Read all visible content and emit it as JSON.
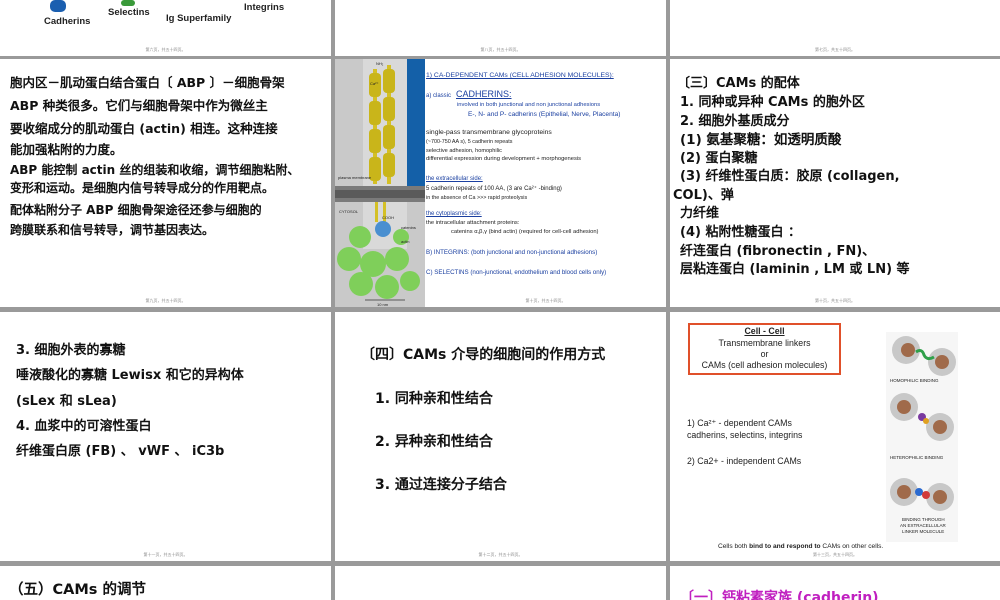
{
  "top_row": {
    "labels": [
      "Cadherins",
      "Selectins",
      "Ig Superfamily",
      "Integrins"
    ]
  },
  "footers": {
    "s_top1": "第六页，共五十四页。",
    "s_top2": "第八页，共五十四页。",
    "s_top3": "第七页，共五十四页。",
    "s1": "第九页，共五十四页。",
    "s2": "第十页，共五十四页。",
    "s3": "第十页，共五十四页。",
    "s4": "第十一页，共五十四页。",
    "s5": "第十二页，共五十四页。",
    "s6": "第十三页，共五十四页。"
  },
  "slide1": {
    "lines": [
      "胞内区－肌动蛋白结合蛋白〔 ABP 〕－细胞骨架",
      "  ABP 种类很多。它们与细胞骨架中作为微丝主",
      "要收缩成分的肌动蛋白 (actin) 相连。这种连接",
      "能加强粘附的力度。",
      "    ABP 能控制 actin 丝的组装和收缩，调节细胞粘附、",
      "变形和运动。是细胞内信号转导成分的作用靶点。",
      "    配体粘附分子 ABP 细胞骨架途径还参与细胞的",
      "跨膜联系和信号转导，调节基因表达。"
    ]
  },
  "slide2": {
    "heading1": "1)  CA-DEPENDENT CAMs  (CELL ADHESION MOLECULES):",
    "classic": "a)  classic",
    "cadherins": "CADHERINS:",
    "c1": "involved in both junctional and non junctional adhesions",
    "c2": "E-, N- and P- cadherins (Epithelial, Nerve, Placenta)",
    "sp": "single-pass transmembrane glycoproteins",
    "sp2": "(~700-750 AA s), 5 cadherin repeats",
    "sp3": "selective adhesion, homophilic",
    "sp4": "differential expression during development + morphogenesis",
    "ext": "the extracellular side:",
    "ext2": "5 cadherin repeats of 100 AA,    (3 are Ca²⁺ -binding)",
    "ext3": "in the absence of Ca >>> rapid proteolysis",
    "cyt": "the cytoplasmic side:",
    "cyt2": "the intracellular attachment proteins:",
    "cyt3": "catenins α,β,γ (bind actin) (required for cell-cell adhesion)",
    "b": "B) INTEGRINS:  (both junctional and non-junctional adhesions)",
    "c": "C) SELECTINS (non-junctional, endothelium and blood cells only)",
    "fig_labels": [
      "plasma membrane",
      "CYTOSOL",
      "COOH",
      "catenins",
      "actin",
      "10 nm",
      "NH₂"
    ],
    "ca_label": "Ca²⁺"
  },
  "slide3": {
    "lines": [
      "〔三〕CAMs 的配体",
      "1.  同种或异种 CAMs 的胞外区",
      "2.  细胞外基质成分",
      "  (1)  氨基聚糖：如透明质酸",
      "     (2)  蛋白聚糖",
      "     (3)  纤维性蛋白质：胶原 (collagen,",
      "COL)、弹",
      "         力纤维",
      "     (4)  粘附性糖蛋白 ：",
      "          纤连蛋白 (fibronectin , FN)、",
      "          层粘连蛋白 (laminin , LM 或 LN) 等"
    ]
  },
  "slide4": {
    "lines": [
      "3. 细胞外表的寡糖",
      "   唾液酸化的寡糖 Lewisx  和它的异构体",
      "(sLex 和 sLea)",
      "4. 血浆中的可溶性蛋白",
      "   纤维蛋白原 (FB)  、 vWF 、 iC3b"
    ]
  },
  "slide5": {
    "title": "〔四〕CAMs 介导的细胞间的作用方式",
    "items": [
      "1. 同种亲和性结合",
      "2. 异种亲和性结合",
      "3. 通过连接分子结合"
    ]
  },
  "slide6": {
    "box_title": "Cell - Cell",
    "box_l1": "Transmembrane linkers",
    "box_l2": "or",
    "box_l3": "CAMs (cell adhesion molecules)",
    "p1": "1) Ca²⁺ - dependent CAMs",
    "p1b": "cadherins, selectins, integrins",
    "p2": "2)  Ca2+ - independent CAMs",
    "cap1": "HOMOPHILIC BINDING",
    "cap2": "HETEROPHILIC BINDING",
    "cap3a": "BINDING THROUGH",
    "cap3b": "AN EXTRACELLULAR",
    "cap3c": "LINKER MOLECULE",
    "bottom_pre": "Cells both ",
    "bottom_bold": "bind to and respond to",
    "bottom_post": " CAMs on other cells."
  },
  "slide7": {
    "title": "（五）CAMs 的调节"
  },
  "slide9": {
    "title": "〔一〕钙粘素家族 (cadherin)"
  }
}
